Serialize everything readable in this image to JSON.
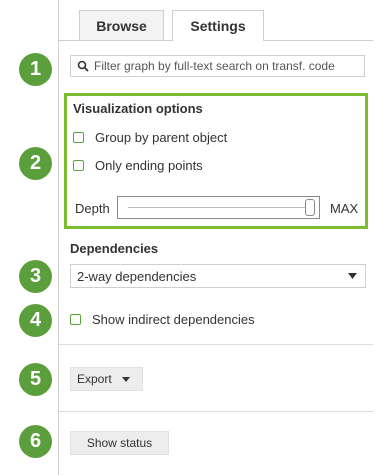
{
  "tabs": [
    {
      "label": "Browse",
      "active": false
    },
    {
      "label": "Settings",
      "active": true
    }
  ],
  "search": {
    "placeholder": "Filter graph by full-text search on transf. code",
    "value": ""
  },
  "visualization": {
    "title": "Visualization options",
    "options": [
      {
        "label": "Group by parent object",
        "checked": false
      },
      {
        "label": "Only ending points",
        "checked": false
      }
    ],
    "depth": {
      "label": "Depth",
      "max_label": "MAX",
      "value": 1.0
    }
  },
  "dependencies": {
    "title": "Dependencies",
    "selected": "2-way dependencies",
    "indirect": {
      "label": "Show indirect dependencies",
      "checked": false
    }
  },
  "export": {
    "label": "Export"
  },
  "status": {
    "label": "Show status"
  },
  "badges": [
    "1",
    "2",
    "3",
    "4",
    "5",
    "6"
  ],
  "colors": {
    "badge": "#5b9f3c",
    "highlight": "#7cbd2f",
    "checkbox": "#5aa53a"
  }
}
